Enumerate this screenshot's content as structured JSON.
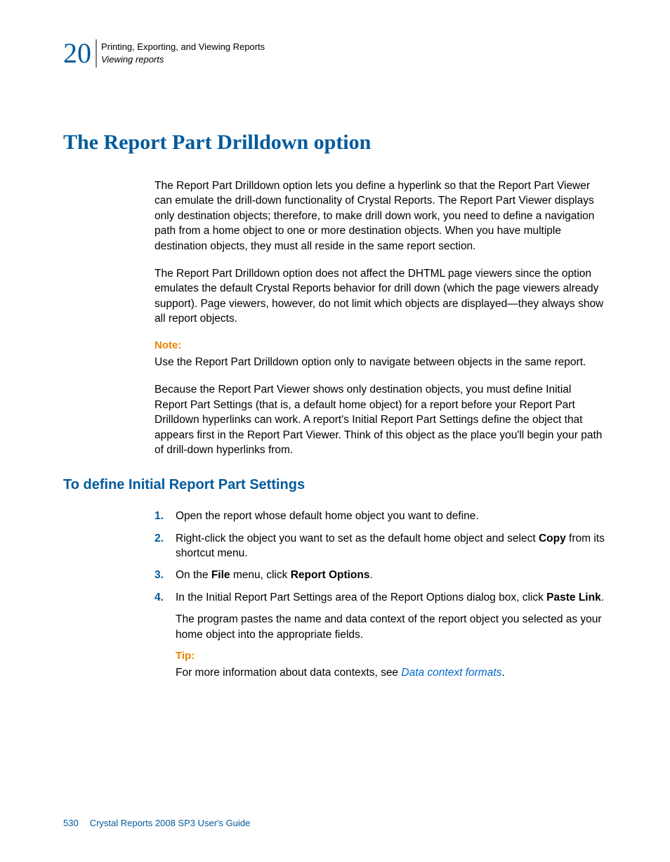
{
  "header": {
    "chapter_number": "20",
    "chapter_title": "Printing, Exporting, and Viewing Reports",
    "section_title": "Viewing reports"
  },
  "main_heading": "The Report Part Drilldown option",
  "paragraphs": {
    "p1": "The Report Part Drilldown option lets you define a hyperlink so that the Report Part Viewer can emulate the drill-down functionality of Crystal Reports. The Report Part Viewer displays only destination objects; therefore, to make drill down work, you need to define a navigation path from a home object to one or more destination objects. When you have multiple destination objects, they must all reside in the same report section.",
    "p2": "The Report Part Drilldown option does not affect the DHTML page viewers since the option emulates the default Crystal Reports behavior for drill down (which the page viewers already support). Page viewers, however, do not limit which objects are displayed—they always show all report objects.",
    "note_label": "Note:",
    "note_text": "Use the Report Part Drilldown option only to navigate between objects in the same report.",
    "p3": "Because the Report Part Viewer shows only destination objects, you must define Initial Report Part Settings (that is, a default home object) for a report before your Report Part Drilldown hyperlinks can work. A report's Initial Report Part Settings define the object that appears first in the Report Part Viewer. Think of this object as the place you'll begin your path of drill-down hyperlinks from."
  },
  "sub_heading": "To define Initial Report Part Settings",
  "steps": {
    "s1": "Open the report whose default home object you want to define.",
    "s2_pre": "Right-click the object you want to set as the default home object and select ",
    "s2_bold": "Copy",
    "s2_post": " from its shortcut menu.",
    "s3_pre": "On the ",
    "s3_b1": "File",
    "s3_mid": " menu, click ",
    "s3_b2": "Report Options",
    "s3_post": ".",
    "s4_pre": "In the Initial Report Part Settings area of the Report Options dialog box, click ",
    "s4_bold": "Paste Link",
    "s4_post": ".",
    "s4_result": "The program pastes the name and data context of the report object you selected as your home object into the appropriate fields.",
    "tip_label": "Tip:",
    "tip_pre": "For more information about data contexts, see ",
    "tip_link": "Data context formats",
    "tip_post": "."
  },
  "footer": {
    "page_number": "530",
    "doc_title": "Crystal Reports 2008 SP3 User's Guide"
  }
}
